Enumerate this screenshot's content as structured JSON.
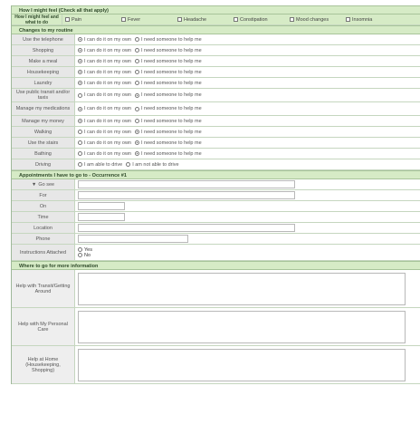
{
  "section_feel": {
    "title": "How I might feel (Check all that apply)",
    "row_label": "How I might feel and what to do",
    "options": [
      "Pain",
      "Fever",
      "Headache",
      "Constipation",
      "Mood changes",
      "Insomnia"
    ]
  },
  "section_routine": {
    "title": "Changes to my routine",
    "opt_own": "I can do it on my own",
    "opt_help": "I need someone to help me",
    "rows": [
      {
        "label": "Use the telephone",
        "sel": "own"
      },
      {
        "label": "Shopping",
        "sel": "own"
      },
      {
        "label": "Make a meal",
        "sel": "own"
      },
      {
        "label": "Housekeeping",
        "sel": "own"
      },
      {
        "label": "Laundry",
        "sel": "own"
      },
      {
        "label": "Use public transit and/or taxis",
        "sel": "help"
      },
      {
        "label": "Manage my medications",
        "sel": "own"
      },
      {
        "label": "Manage my money",
        "sel": "own"
      },
      {
        "label": "Walking",
        "sel": "help"
      },
      {
        "label": "Use the stairs",
        "sel": "help"
      },
      {
        "label": "Bathing",
        "sel": "help"
      }
    ],
    "driving": {
      "label": "Driving",
      "opt_a": "I am able to drive",
      "opt_b": "I am not able to drive"
    }
  },
  "section_appt": {
    "title": "Appointments I have to go to - Occurrence #1",
    "rows": [
      {
        "label": "Go see",
        "icon": "triangle-right-icon"
      },
      {
        "label": "For"
      },
      {
        "label": "On"
      },
      {
        "label": "Time"
      },
      {
        "label": "Location"
      },
      {
        "label": "Phone"
      }
    ],
    "instructions": {
      "label": "Instructions Attached",
      "yes": "Yes",
      "no": "No"
    }
  },
  "section_info": {
    "title": "Where to go for more information",
    "rows": [
      {
        "label": "Help with Transit/Getting Around"
      },
      {
        "label": "Help with My Personal Care"
      },
      {
        "label": "Help at Home (Housekeeping, Shopping)"
      }
    ]
  },
  "colors": {
    "section_bg": "#d6ebc6",
    "label_bg": "#e7e7e7",
    "border": "#a8c49a"
  }
}
